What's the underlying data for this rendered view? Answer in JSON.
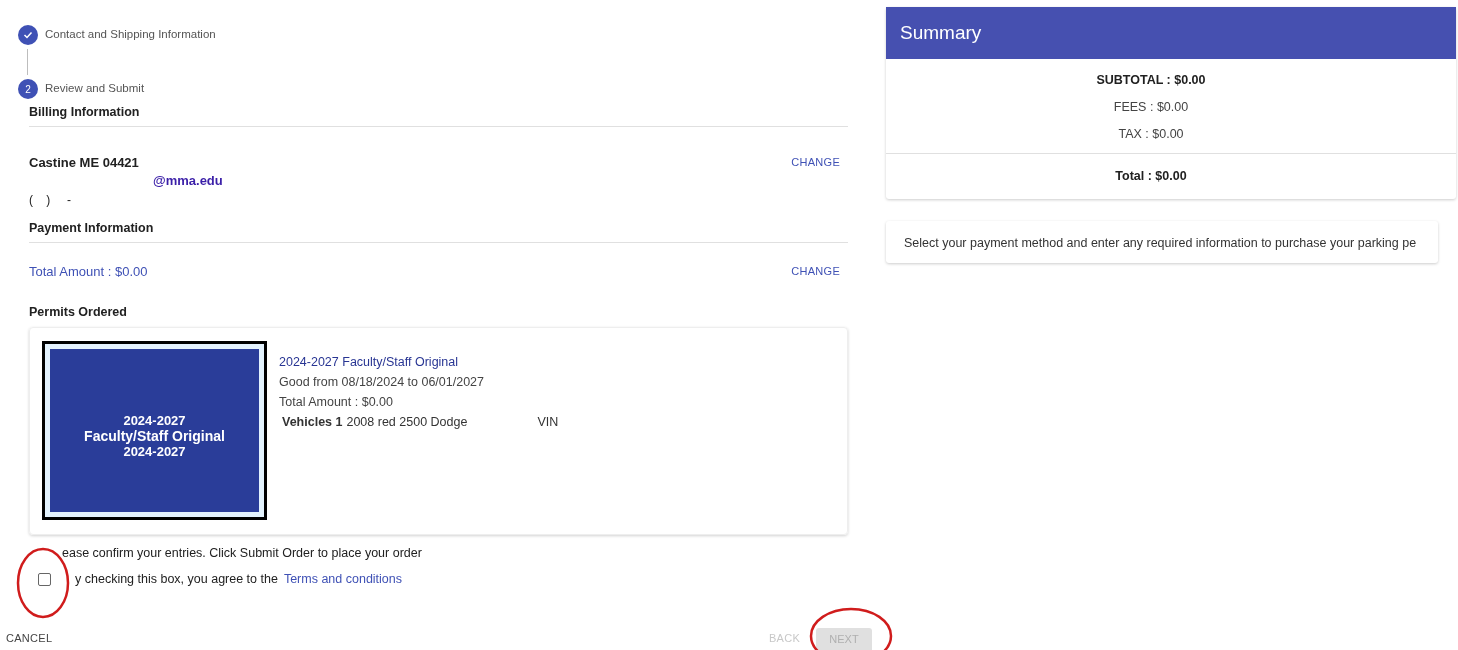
{
  "stepper": [
    {
      "label": "Contact and Shipping Information",
      "completed": true
    },
    {
      "label": "Review and Submit",
      "number": "2",
      "completed": false
    }
  ],
  "billing": {
    "heading": "Billing Information",
    "address": "Castine ME 04421",
    "email": "@mma.edu",
    "phone": "(    )     -",
    "change": "CHANGE"
  },
  "payment": {
    "heading": "Payment Information",
    "total": "Total Amount : $0.00",
    "change": "CHANGE"
  },
  "permits": {
    "heading": "Permits Ordered",
    "items": [
      {
        "image_lines": [
          "2024-2027",
          "Faculty/Staff Original",
          "2024-2027"
        ],
        "title": "2024-2027 Faculty/Staff Original",
        "validity": "Good from 08/18/2024 to 06/01/2027",
        "total": "Total Amount : $0.00",
        "vehicles_label": "Vehicles 1",
        "vehicle": "2008 red 2500 Dodge",
        "vin": "VIN"
      }
    ]
  },
  "confirm": {
    "text": "ease confirm your entries. Click Submit Order to place your order",
    "agree": "y checking this box, you agree to the",
    "link": "Terms and conditions",
    "checked": false
  },
  "actions": {
    "cancel": "CANCEL",
    "back": {
      "label": "BACK",
      "disabled": true
    },
    "next": {
      "label": "NEXT",
      "disabled": true
    }
  },
  "summary": {
    "title": "Summary",
    "subtotal": "SUBTOTAL : $0.00",
    "fees": "FEES : $0.00",
    "tax": "TAX : $0.00",
    "total": "Total : $0.00"
  },
  "info": "Select your payment method and enter any required information to purchase your parking pe"
}
